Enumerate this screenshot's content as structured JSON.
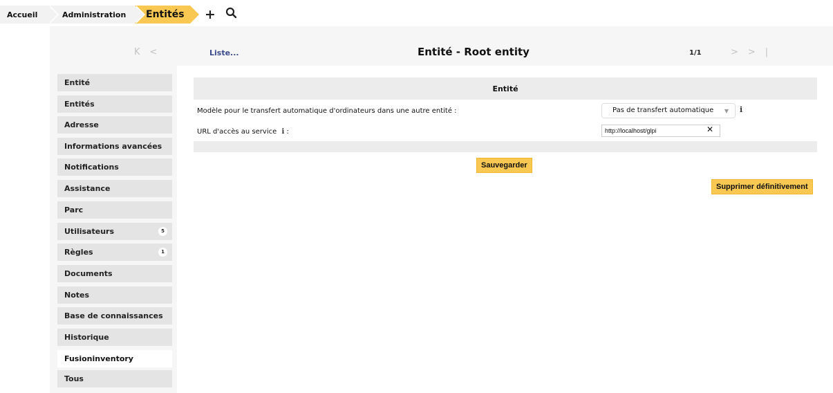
{
  "breadcrumb": {
    "home": "Accueil",
    "admin": "Administration",
    "current": "Entités",
    "add_icon": "+",
    "search_icon": "⚲"
  },
  "header": {
    "list_link": "Liste...",
    "title": "Entité - Root entity",
    "pager": "1/1",
    "prev_arrows": "K <",
    "next_arrows": "> >|"
  },
  "tabs": [
    {
      "label": "Entité",
      "badge": ""
    },
    {
      "label": "Entités",
      "badge": ""
    },
    {
      "label": "Adresse",
      "badge": ""
    },
    {
      "label": "Informations avancées",
      "badge": ""
    },
    {
      "label": "Notifications",
      "badge": ""
    },
    {
      "label": "Assistance",
      "badge": ""
    },
    {
      "label": "Parc",
      "badge": ""
    },
    {
      "label": "Utilisateurs",
      "badge": "5"
    },
    {
      "label": "Règles",
      "badge": "1"
    },
    {
      "label": "Documents",
      "badge": ""
    },
    {
      "label": "Notes",
      "badge": ""
    },
    {
      "label": "Base de connaissances",
      "badge": ""
    },
    {
      "label": "Historique",
      "badge": ""
    },
    {
      "label": "Fusioninventory",
      "badge": ""
    },
    {
      "label": "Tous",
      "badge": ""
    }
  ],
  "form": {
    "section_title": "Entité",
    "transfer_label": "Modèle pour le transfert automatique d'ordinateurs dans une autre entité :",
    "transfer_value": "Pas de transfert automatique",
    "url_label": "URL d'accès au service",
    "url_label_suffix": ":",
    "url_value": "http://localhost/glpi",
    "info_glyph": "i",
    "clear_glyph": "✕",
    "caret_glyph": "▼",
    "save_label": "Sauvegarder",
    "delete_label": "Supprimer définitivement"
  }
}
